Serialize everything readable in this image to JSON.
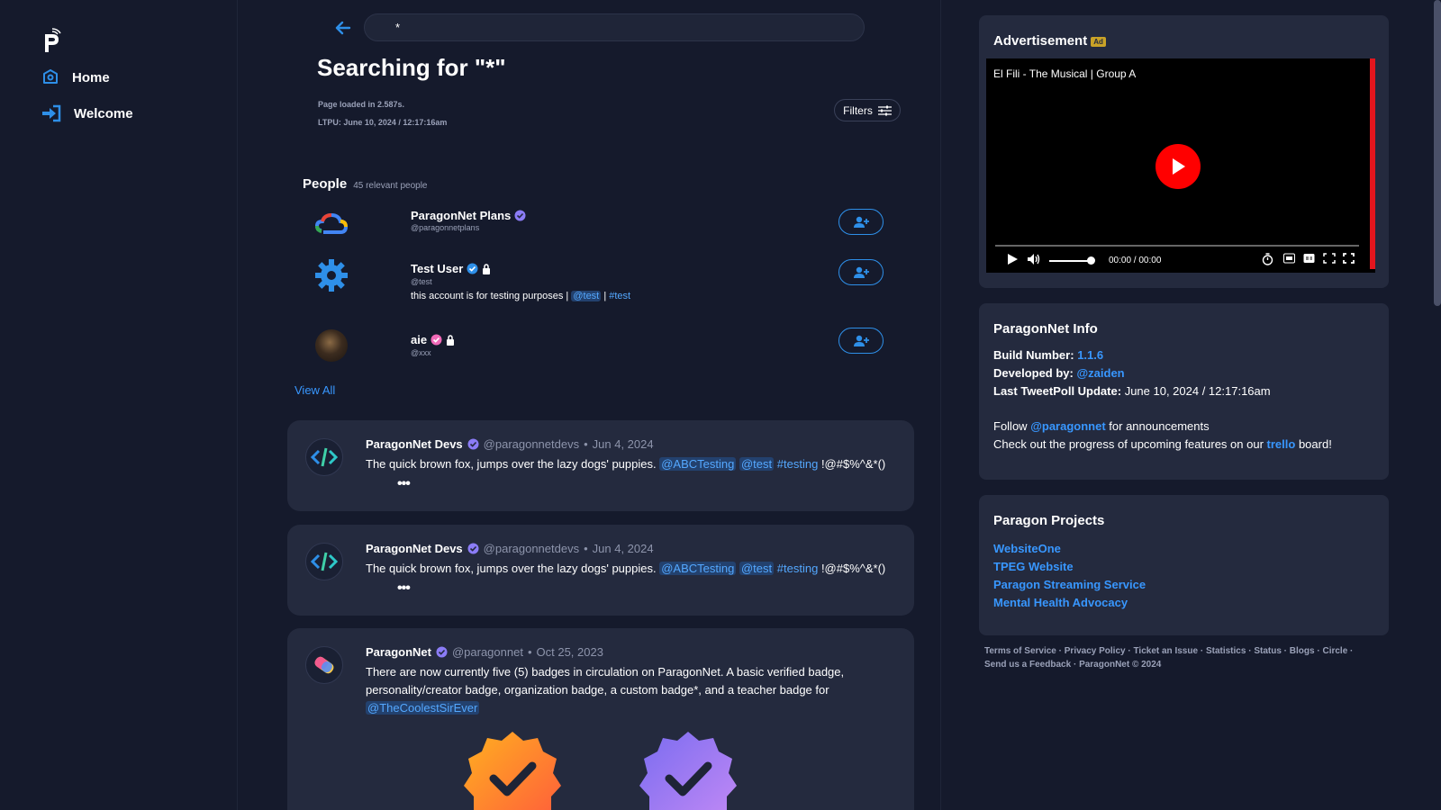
{
  "sidebar": {
    "logo_letter": "P",
    "items": [
      {
        "label": "Home",
        "icon": "home-icon"
      },
      {
        "label": "Welcome",
        "icon": "sign-in-icon"
      }
    ]
  },
  "search": {
    "value": "*",
    "title": "Searching for \"*\"",
    "page_loaded": "Page loaded in 2.587s.",
    "ltpu": "LTPU: June 10, 2024 / 12:17:16am",
    "filters_label": "Filters"
  },
  "people": {
    "heading": "People",
    "count": "45 relevant people",
    "view_all": "View All",
    "list": [
      {
        "name": "ParagonNet Plans",
        "handle": "@paragonnetplans",
        "bio": "",
        "locked": false
      },
      {
        "name": "Test User",
        "handle": "@test",
        "bio_text": "this account is for testing purposes |",
        "bio_mention": "@test",
        "bio_sep": "|",
        "bio_tag": "#test",
        "locked": true
      },
      {
        "name": "aie",
        "handle": "@xxx",
        "locked": true
      }
    ]
  },
  "posts": [
    {
      "name": "ParagonNet Devs",
      "handle": "@paragonnetdevs",
      "sep": "•",
      "date": "Jun 4, 2024",
      "text": "The quick brown fox, jumps over the lazy dogs' puppies.",
      "mention1": "@ABCTesting",
      "mention2": "@test",
      "tag": "#testing",
      "tail": "!@#$%^&*()",
      "more": "•••"
    },
    {
      "name": "ParagonNet Devs",
      "handle": "@paragonnetdevs",
      "sep": "•",
      "date": "Jun 4, 2024",
      "text": "The quick brown fox, jumps over the lazy dogs' puppies.",
      "mention1": "@ABCTesting",
      "mention2": "@test",
      "tag": "#testing",
      "tail": "!@#$%^&*()",
      "more": "•••"
    },
    {
      "name": "ParagonNet",
      "handle": "@paragonnet",
      "sep": "•",
      "date": "Oct 25, 2023",
      "text": "There are now currently five (5) badges in circulation on ParagonNet. A basic verified badge, personality/creator badge, organization badge, a custom badge*, and a teacher badge for",
      "mention1": "@TheCoolestSirEver"
    }
  ],
  "ad": {
    "heading": "Advertisement",
    "badge": "Ad",
    "video_title": "El Fili - The Musical | Group A",
    "time": "00:00 / 00:00"
  },
  "info": {
    "heading": "ParagonNet Info",
    "build_label": "Build Number:",
    "build_value": "1.1.6",
    "dev_label": "Developed by:",
    "dev_value": "@zaiden",
    "update_label": "Last TweetPoll Update:",
    "update_value": "June 10, 2024 / 12:17:16am",
    "follow_pre": "Follow",
    "follow_link": "@paragonnet",
    "follow_post": "for announcements",
    "trello_pre": "Check out the progress of upcoming features on our",
    "trello_link": "trello",
    "trello_post": "board!"
  },
  "projects": {
    "heading": "Paragon Projects",
    "links": [
      "WebsiteOne",
      "TPEG Website",
      "Paragon Streaming Service",
      "Mental Health Advocacy"
    ]
  },
  "footer": {
    "links": [
      "Terms of Service",
      "Privacy Policy",
      "Ticket an Issue",
      "Statistics",
      "Status",
      "Blogs",
      "Circle",
      "Send us a Feedback"
    ],
    "copyright": "ParagonNet © 2024",
    "sep": "·"
  },
  "colors": {
    "background": "#151a2c",
    "card": "#242a3e",
    "accent": "#3897ff",
    "verified": "#8b7cf6",
    "ad_red": "#ff0000"
  }
}
